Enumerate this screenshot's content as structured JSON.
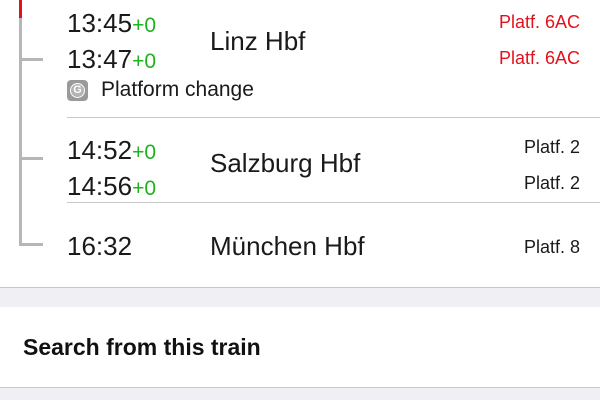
{
  "stops": [
    {
      "station": "Linz Hbf",
      "arrival": {
        "time": "13:45",
        "delay": "+0",
        "platform": "Platf. 6AC",
        "platform_changed": true
      },
      "departure": {
        "time": "13:47",
        "delay": "+0",
        "platform": "Platf. 6AC",
        "platform_changed": true
      },
      "notice": {
        "icon": "G",
        "text": "Platform change"
      }
    },
    {
      "station": "Salzburg Hbf",
      "arrival": {
        "time": "14:52",
        "delay": "+0",
        "platform": "Platf. 2",
        "platform_changed": false
      },
      "departure": {
        "time": "14:56",
        "delay": "+0",
        "platform": "Platf. 2",
        "platform_changed": false
      }
    },
    {
      "station": "München Hbf",
      "arrival": {
        "time": "16:32",
        "platform": "Platf. 8",
        "platform_changed": false
      }
    }
  ],
  "actions": {
    "search_from_train": "Search from this train"
  },
  "colors": {
    "accent_red": "#e4101b",
    "delay_green": "#1db31d",
    "route_grey": "#b6b6b6",
    "group_background": "#efeff4"
  }
}
